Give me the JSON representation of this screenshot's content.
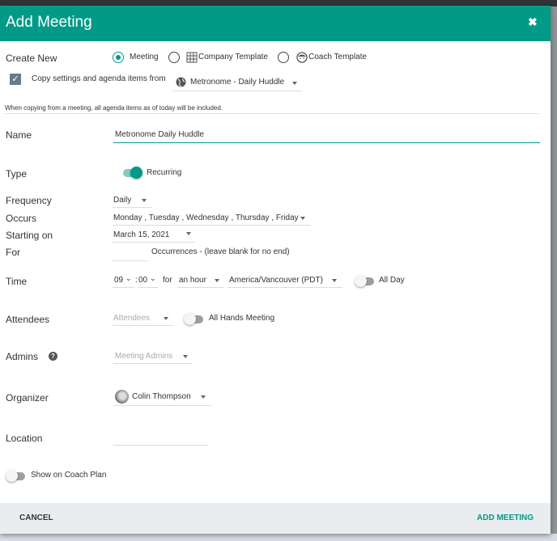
{
  "dialog": {
    "title": "Add Meeting",
    "close_icon": "close-icon"
  },
  "create_new": {
    "label": "Create New",
    "options": [
      {
        "label": "Meeting",
        "selected": true
      },
      {
        "label": "Company Template",
        "selected": false,
        "icon": "building-icon"
      },
      {
        "label": "Coach Template",
        "selected": false,
        "icon": "coach-face-icon"
      }
    ]
  },
  "copy": {
    "label": "Copy settings and agenda items from",
    "checked": true,
    "source": "Metronome - Daily Huddle",
    "source_icon": "globe-icon",
    "note": "When copying from a meeting, all agenda items as of today will be included."
  },
  "name": {
    "label": "Name",
    "value": "Metronome Daily Huddle"
  },
  "type": {
    "label": "Type",
    "toggle_label": "Recurring",
    "recurring": true
  },
  "frequency": {
    "label": "Frequency",
    "value": "Daily"
  },
  "occurs": {
    "label": "Occurs",
    "value": "Monday , Tuesday , Wednesday , Thursday , Friday"
  },
  "starting": {
    "label": "Starting on",
    "value": "March 15, 2021"
  },
  "for": {
    "label": "For",
    "value": "",
    "suffix": "Occurrences - (leave blank for no end)"
  },
  "time": {
    "label": "Time",
    "hour": "09",
    "minute": "00",
    "sep": ":",
    "for_word": "for",
    "duration": "an hour",
    "timezone": "America/Vancouver (PDT)",
    "all_day_label": "All Day",
    "all_day": false
  },
  "attendees": {
    "label": "Attendees",
    "placeholder": "Attendees",
    "all_hands_label": "All Hands Meeting",
    "all_hands": false
  },
  "admins": {
    "label": "Admins",
    "placeholder": "Meeting Admins",
    "help_icon": "help-icon"
  },
  "organizer": {
    "label": "Organizer",
    "value": "Colin Thompson"
  },
  "location": {
    "label": "Location",
    "value": ""
  },
  "coach_plan": {
    "label": "Show on Coach Plan",
    "on": false
  },
  "footer": {
    "cancel": "CANCEL",
    "add": "ADD MEETING"
  },
  "colors": {
    "accent": "#019a86",
    "footer_bg": "#eaedf0"
  }
}
